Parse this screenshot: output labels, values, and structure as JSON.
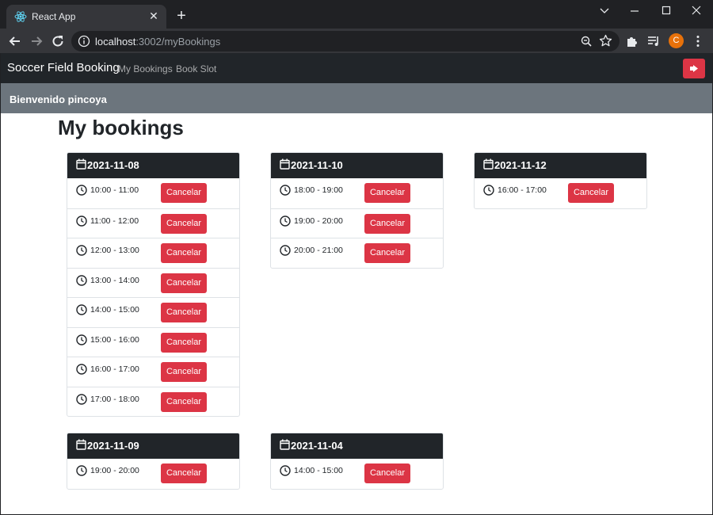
{
  "browser": {
    "tab_title": "React App",
    "url_host": "localhost",
    "url_path": ":3002/myBookings",
    "profile_initial": "C"
  },
  "app": {
    "brand": "Soccer Field Booking",
    "nav": [
      "My Bookings",
      "Book Slot"
    ],
    "welcome": "Bienvenido pincoya",
    "page_title": "My bookings",
    "cancel_label": "Cancelar",
    "colors": {
      "navbar": "#212529",
      "welcome_bar": "#6c757d",
      "danger": "#dc3545"
    }
  },
  "bookings": [
    {
      "date": "2021-11-08",
      "slots": [
        "10:00 - 11:00",
        "11:00 - 12:00",
        "12:00 - 13:00",
        "13:00 - 14:00",
        "14:00 - 15:00",
        "15:00 - 16:00",
        "16:00 - 17:00",
        "17:00 - 18:00"
      ]
    },
    {
      "date": "2021-11-10",
      "slots": [
        "18:00 - 19:00",
        "19:00 - 20:00",
        "20:00 - 21:00"
      ]
    },
    {
      "date": "2021-11-12",
      "slots": [
        "16:00 - 17:00"
      ]
    },
    {
      "date": "2021-11-09",
      "slots": [
        "19:00 - 20:00"
      ]
    },
    {
      "date": "2021-11-04",
      "slots": [
        "14:00 - 15:00"
      ]
    }
  ]
}
